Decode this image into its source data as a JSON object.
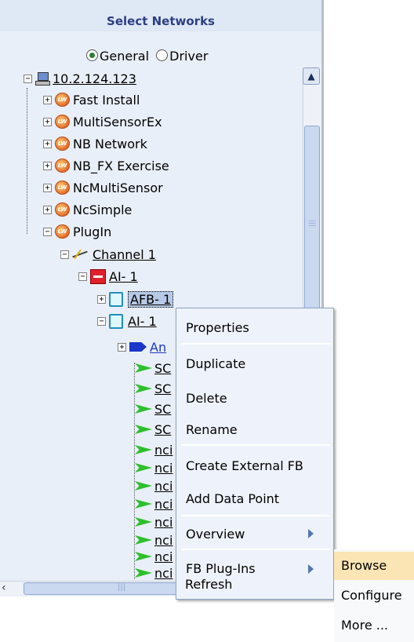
{
  "header": {
    "title": "Select Networks"
  },
  "mode": {
    "general_label": "General",
    "driver_label": "Driver",
    "selected": "General"
  },
  "tree": {
    "root": "10.2.124.123",
    "networks": [
      "Fast Install",
      "MultiSensorEx",
      "NB Network",
      "NB_FX Exercise",
      "NcMultiSensor",
      "NcSimple",
      "PlugIn"
    ],
    "channel": "Channel 1",
    "device": "AI- 1",
    "afb": "AFB- 1",
    "ai_fb": "AI- 1",
    "child_partial": "An",
    "points": [
      "SC",
      "SC",
      "SC",
      "SC",
      "nci",
      "nci",
      "nci",
      "nci",
      "nci",
      "nci",
      "nci",
      "nci"
    ]
  },
  "context_menu": {
    "items": [
      "Properties",
      "Duplicate",
      "Delete",
      "Rename",
      "Create External FB",
      "Add Data Point",
      "Overview",
      "FB Plug-Ins",
      "Refresh"
    ]
  },
  "submenu": {
    "items": [
      "Browse",
      "Configure",
      "More ..."
    ],
    "highlighted": "Browse"
  },
  "colors": {
    "header_text": "#2d3f84",
    "menu_bg": "#eef3fb",
    "highlight": "#fbe5b5",
    "panel_bg": "#e9eff8"
  }
}
